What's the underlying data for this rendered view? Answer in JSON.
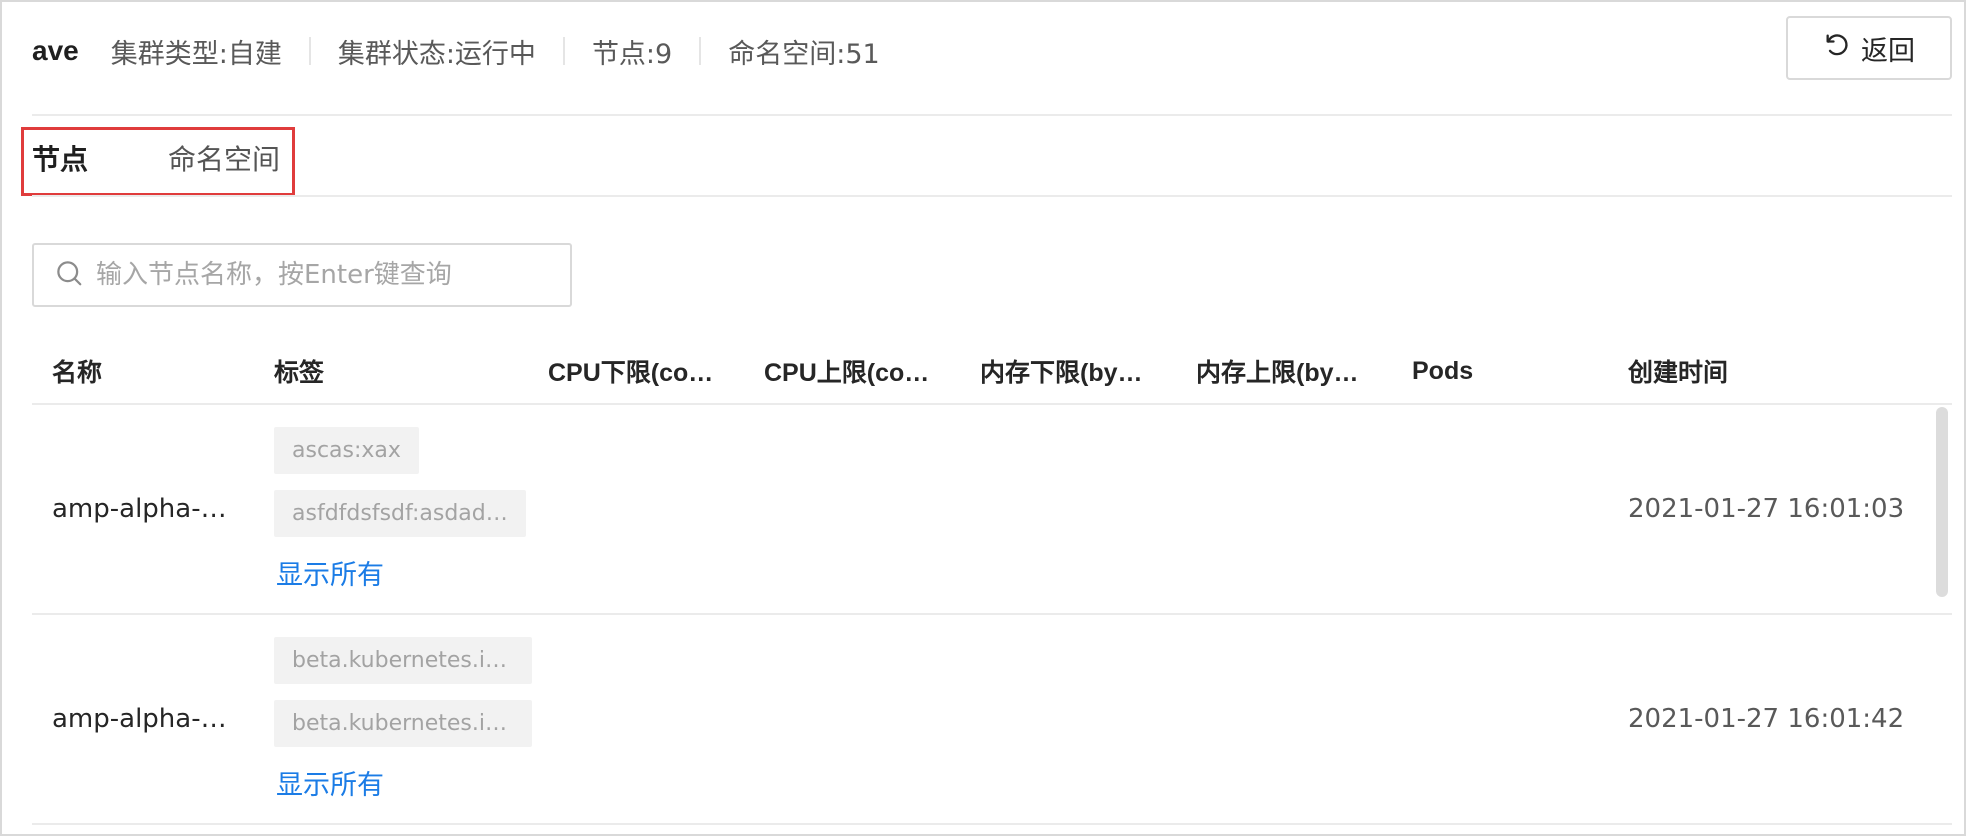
{
  "header": {
    "cluster_name": "ave",
    "meta": [
      "集群类型:自建",
      "集群状态:运行中",
      "节点:9",
      "命名空间:51"
    ],
    "back_label": "返回"
  },
  "tabs": [
    {
      "label": "节点",
      "active": true
    },
    {
      "label": "命名空间",
      "active": false
    }
  ],
  "search": {
    "placeholder": "输入节点名称，按Enter键查询",
    "value": ""
  },
  "table": {
    "columns": [
      "名称",
      "标签",
      "CPU下限(co…",
      "CPU上限(co…",
      "内存下限(by…",
      "内存上限(by…",
      "Pods",
      "创建时间"
    ],
    "rows": [
      {
        "name": "amp-alpha-…",
        "tags": [
          "ascas:xax",
          "asfdfdsfsdf:asdad…"
        ],
        "show_all": "显示所有",
        "cpu_lower": "",
        "cpu_upper": "",
        "mem_lower": "",
        "mem_upper": "",
        "pods": "",
        "created": "2021-01-27 16:01:03"
      },
      {
        "name": "amp-alpha-…",
        "tags": [
          "beta.kubernetes.io…",
          "beta.kubernetes.io…"
        ],
        "show_all": "显示所有",
        "cpu_lower": "",
        "cpu_upper": "",
        "mem_lower": "",
        "mem_upper": "",
        "pods": "",
        "created": "2021-01-27 16:01:42"
      }
    ]
  },
  "icons": {
    "back": "undo-arrow-icon",
    "search": "search-icon"
  },
  "colors": {
    "link": "#1b7ce6",
    "tab_indicator": "#6b46c1",
    "highlight_box": "#e03c3c"
  }
}
